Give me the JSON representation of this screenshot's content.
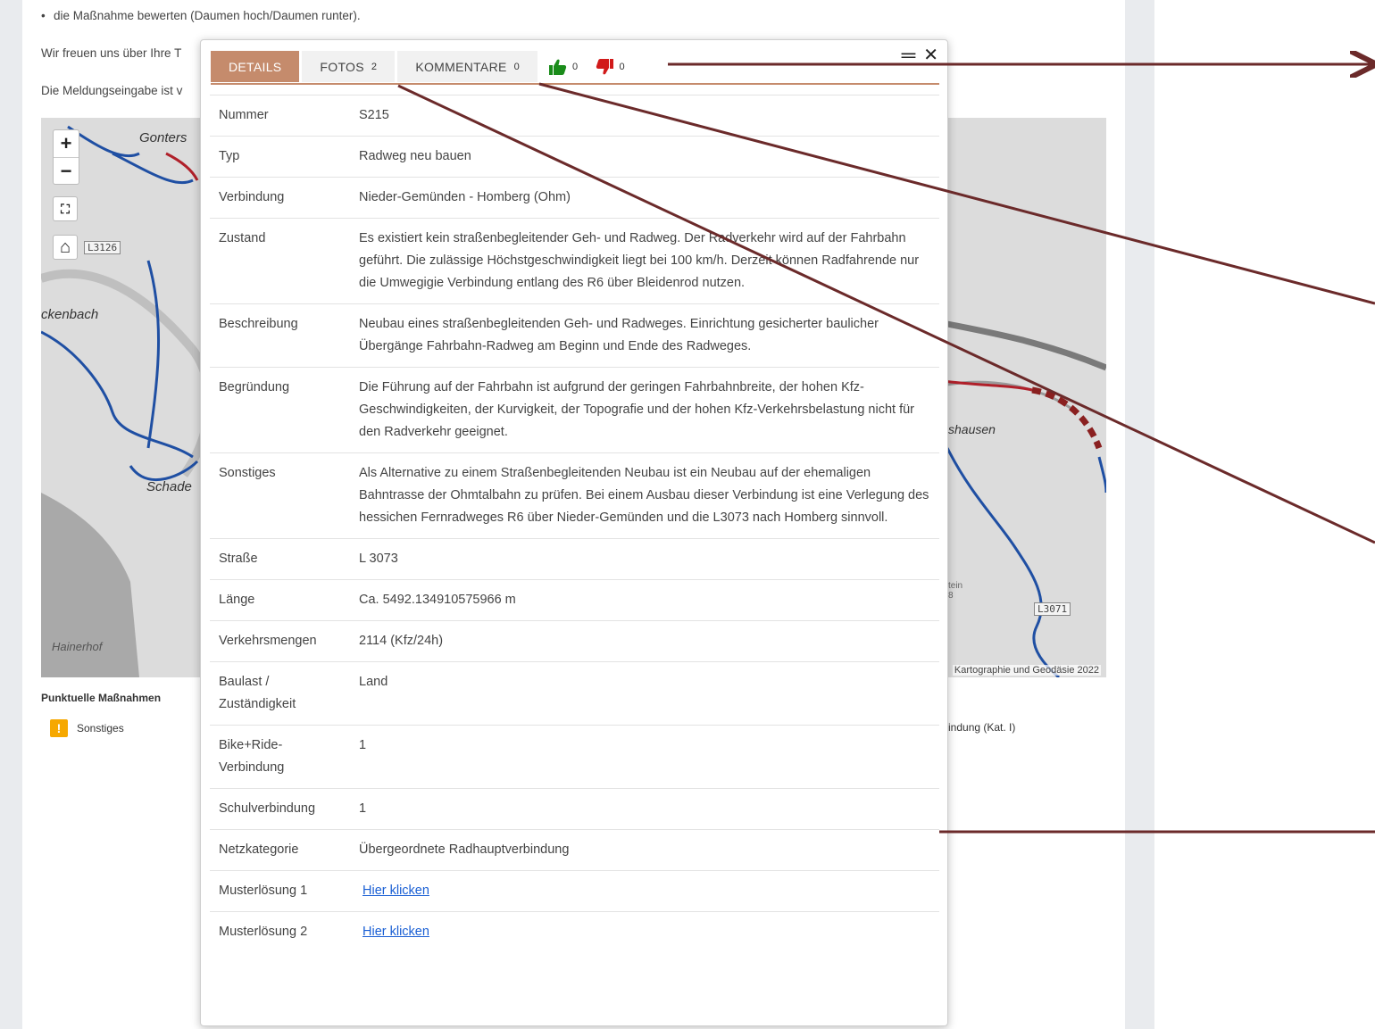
{
  "page": {
    "bullet": "die Maßnahme bewerten (Daumen hoch/Daumen runter).",
    "thanks_text": "Wir freuen uns über Ihre T",
    "input_text": "Die Meldungseingabe ist v"
  },
  "map": {
    "labels": [
      "Gonters",
      "ckenbach",
      "Schade",
      "Hainerhof",
      "shausen",
      "tein",
      "8"
    ],
    "road_badges": [
      "L3126",
      "L3071"
    ],
    "attribution": "Kartographie und Geodäsie 2022",
    "controls": {
      "zoom_in": "+",
      "zoom_out": "−",
      "fullscreen": "⛶",
      "home": "⌂"
    }
  },
  "legend": {
    "title": "Punktuelle Maßnahmen",
    "item_icon": "!",
    "item_label": "Sonstiges",
    "right_label": "indung (Kat. I)"
  },
  "popup": {
    "tabs": [
      {
        "label": "DETAILS",
        "active": true
      },
      {
        "label": "FOTOS",
        "count": "2"
      },
      {
        "label": "KOMMENTARE",
        "count": "0"
      }
    ],
    "votes": {
      "up_count": "0",
      "down_count": "0",
      "up_color": "#1a8c1a",
      "down_color": "#d11a1a"
    },
    "header_icons": {
      "menu": "═",
      "close": "✕"
    },
    "rows": [
      {
        "key": "Nummer",
        "value": "S215"
      },
      {
        "key": "Typ",
        "value": "Radweg neu bauen"
      },
      {
        "key": "Verbindung",
        "value": "Nieder-Gemünden - Homberg (Ohm)"
      },
      {
        "key": "Zustand",
        "value": "Es existiert kein straßenbegleitender Geh- und Radweg. Der Radverkehr wird auf der Fahrbahn geführt. Die zulässige Höchstgeschwindigkeit liegt bei 100 km/h. Derzeit können Radfahrende nur die Umwegigie Verbindung entlang des R6 über Bleidenrod nutzen."
      },
      {
        "key": "Beschreibung",
        "value": "Neubau eines straßenbegleitenden Geh- und Radweges. Einrichtung gesicherter baulicher Übergänge Fahrbahn-Radweg am Beginn und Ende des Radweges."
      },
      {
        "key": "Begründung",
        "value": "Die Führung auf der Fahrbahn ist aufgrund der geringen Fahrbahnbreite, der hohen Kfz-Geschwindigkeiten, der Kurvigkeit, der Topografie und der hohen Kfz-Verkehrsbelastung nicht für den Radverkehr geeignet."
      },
      {
        "key": "Sonstiges",
        "value": "Als Alternative zu einem Straßenbegleitenden Neubau ist ein Neubau auf der ehemaligen Bahntrasse der Ohmtalbahn zu prüfen. Bei einem Ausbau dieser Verbindung ist eine Verlegung des hessichen Fernradweges R6 über Nieder-Gemünden und die L3073 nach Homberg sinnvoll."
      },
      {
        "key": "Straße",
        "value": "L 3073"
      },
      {
        "key": "Länge",
        "value": "Ca. 5492.134910575966 m"
      },
      {
        "key": "Verkehrsmengen",
        "value": "2114 (Kfz/24h)"
      },
      {
        "key": "Baulast / Zuständigkeit",
        "value": "Land"
      },
      {
        "key": "Bike+Ride-Verbindung",
        "value": "1"
      },
      {
        "key": "Schulverbindung",
        "value": "1"
      },
      {
        "key": "Netzkategorie",
        "value": "Übergeordnete Radhauptverbindung"
      },
      {
        "key": "Musterlösung 1",
        "link": "Hier klicken"
      },
      {
        "key": "Musterlösung 2",
        "link": "Hier klicken"
      }
    ]
  },
  "colors": {
    "accent": "#c58b6c",
    "annotation_arrow": "#6b2a2a",
    "route_blue": "#1f4fa3",
    "route_red": "#b0202a"
  }
}
